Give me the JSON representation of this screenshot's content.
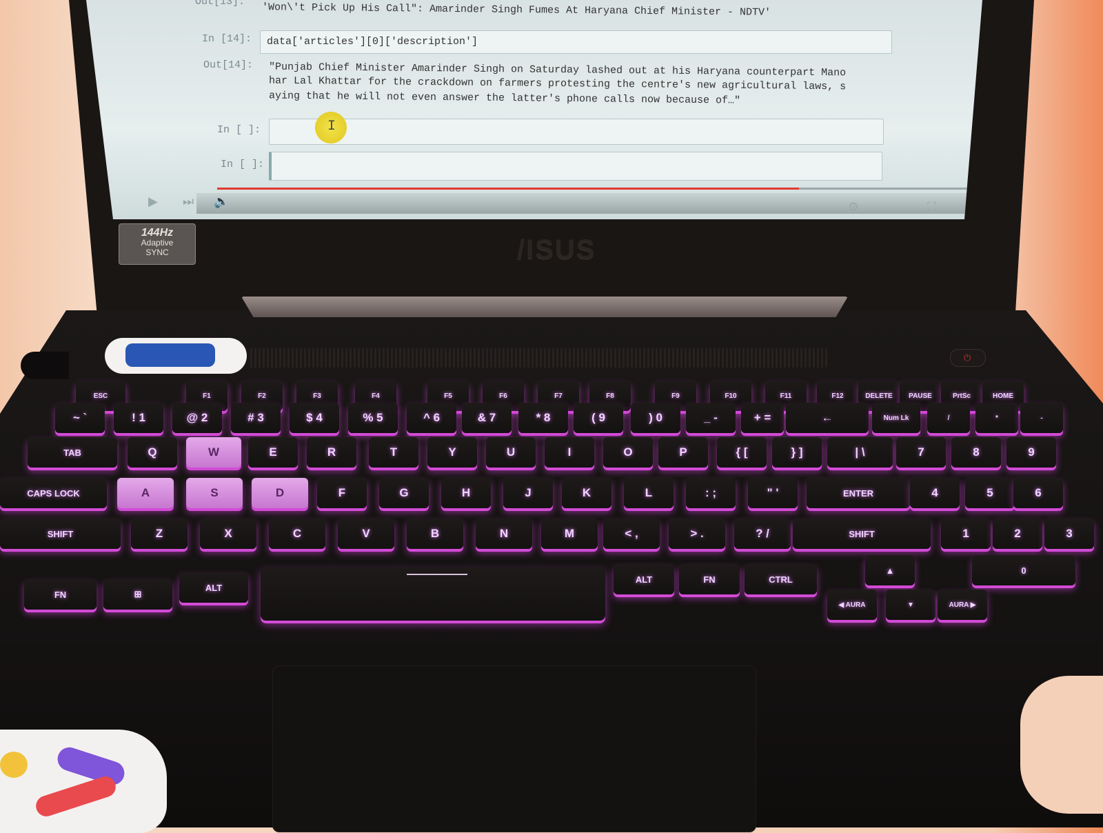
{
  "notebook": {
    "out13_prompt": "Out[13]:",
    "out13_text": "'Won\\'t Pick Up His Call\": Amarinder Singh Fumes At Haryana Chief Minister - NDTV'",
    "in14_prompt": "In [14]:",
    "in14_code": "data['articles'][0]['description']",
    "out14_prompt": "Out[14]:",
    "out14_lines": [
      "\"Punjab Chief Minister Amarinder Singh on Saturday lashed out at his Haryana counterpart Mano",
      "har Lal Khattar for the crackdown on farmers protesting the centre's new agricultural laws, s",
      "aying that he will not even answer the latter's phone calls now because of…\""
    ],
    "empty_prompt_1": "In [ ]:",
    "empty_prompt_2": "In [ ]:",
    "cursor_glyph": "I"
  },
  "video_player": {
    "progress": 0.74
  },
  "bezel": {
    "brand_logo": "/ISUS",
    "badge_rate": "144Hz",
    "badge_line1": "Adaptive",
    "badge_line2": "SYNC"
  },
  "keyboard": {
    "fn_row": [
      "ESC",
      "F1",
      "F2",
      "F3",
      "F4",
      "F5",
      "F6",
      "F7",
      "F8",
      "F9",
      "F10",
      "F11",
      "F12",
      "DELETE",
      "PAUSE",
      "PrtSc",
      "HOME"
    ],
    "number_row": [
      "~ `",
      "! 1",
      "@ 2",
      "# 3",
      "$ 4",
      "% 5",
      "^ 6",
      "& 7",
      "* 8",
      "( 9",
      ") 0",
      "_ -",
      "+ =",
      "←",
      "Num Lk",
      "/",
      "*",
      "-"
    ],
    "qwerty_row": [
      "TAB",
      "Q",
      "W",
      "E",
      "R",
      "T",
      "Y",
      "U",
      "I",
      "O",
      "P",
      "{ [",
      "} ]",
      "| \\",
      "7",
      "8",
      "9"
    ],
    "home_row": [
      "CAPS LOCK",
      "A",
      "S",
      "D",
      "F",
      "G",
      "H",
      "J",
      "K",
      "L",
      ": ;",
      "\" '",
      "ENTER",
      "4",
      "5",
      "6"
    ],
    "shift_row": [
      "SHIFT",
      "Z",
      "X",
      "C",
      "V",
      "B",
      "N",
      "M",
      "< ,",
      "> .",
      "? /",
      "SHIFT",
      "1",
      "2",
      "3"
    ],
    "bottom_row": [
      "FN",
      "⊞",
      "ALT",
      "ALT",
      "FN",
      "CTRL",
      "▲",
      "0"
    ],
    "arrow_row": [
      "◀ AURA",
      "▼",
      "AURA ▶"
    ]
  },
  "colors": {
    "backlight": "#d24bd6",
    "screen_bg": "#e6eeee",
    "progress": "#e03a2e"
  }
}
